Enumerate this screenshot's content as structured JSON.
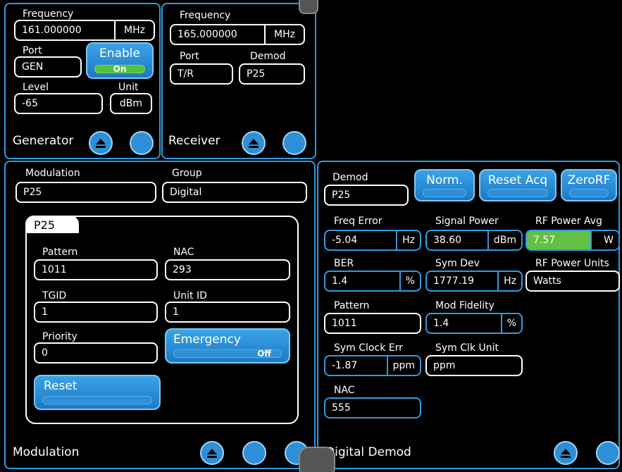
{
  "generator": {
    "title": "Generator",
    "frequency_label": "Frequency",
    "frequency_value": "161.000000",
    "frequency_unit": "MHz",
    "port_label": "Port",
    "port_value": "GEN",
    "enable_label": "Enable",
    "enable_state": "On",
    "level_label": "Level",
    "level_value": "-65",
    "unit_label": "Unit",
    "unit_value": "dBm"
  },
  "receiver": {
    "title": "Receiver",
    "frequency_label": "Frequency",
    "frequency_value": "165.000000",
    "frequency_unit": "MHz",
    "port_label": "Port",
    "port_value": "T/R",
    "demod_label": "Demod",
    "demod_value": "P25"
  },
  "modulation": {
    "title": "Modulation",
    "modulation_label": "Modulation",
    "modulation_value": "P25",
    "group_label": "Group",
    "group_value": "Digital",
    "tab_label": "P25",
    "pattern_label": "Pattern",
    "pattern_value": "1011",
    "nac_label": "NAC",
    "nac_value": "293",
    "tgid_label": "TGID",
    "tgid_value": "1",
    "unit_id_label": "Unit ID",
    "unit_id_value": "1",
    "priority_label": "Priority",
    "priority_value": "0",
    "emergency_label": "Emergency",
    "emergency_state": "Off",
    "reset_label": "Reset"
  },
  "digital_demod": {
    "title": "Digital Demod",
    "demod_label": "Demod",
    "demod_value": "P25",
    "norm_label": "Norm.",
    "reset_acq_label": "Reset Acq",
    "zero_rf_label": "ZeroRF",
    "freq_error_label": "Freq Error",
    "freq_error_value": "-5.04",
    "freq_error_unit": "Hz",
    "signal_power_label": "Signal Power",
    "signal_power_value": "38.60",
    "signal_power_unit": "dBm",
    "rf_power_avg_label": "RF Power Avg",
    "rf_power_avg_value": "7.57",
    "rf_power_avg_unit": "W",
    "ber_label": "BER",
    "ber_value": "1.4",
    "ber_unit": "%",
    "sym_dev_label": "Sym Dev",
    "sym_dev_value": "1777.19",
    "sym_dev_unit": "Hz",
    "rf_power_units_label": "RF Power Units",
    "rf_power_units_value": "Watts",
    "pattern_label": "Pattern",
    "pattern_value": "1011",
    "mod_fidelity_label": "Mod Fidelity",
    "mod_fidelity_value": "1.4",
    "mod_fidelity_unit": "%",
    "sym_clock_err_label": "Sym Clock Err",
    "sym_clock_err_value": "-1.87",
    "sym_clock_err_unit": "ppm",
    "sym_clk_unit_label": "Sym Clk Unit",
    "sym_clk_unit_value": "ppm",
    "nac_label": "NAC",
    "nac_value": "555"
  },
  "icons": {
    "collapse": "eject-up-icon",
    "expand": "circle-button-icon",
    "options": "handle-icon"
  },
  "colors": {
    "accent": "#2f9be0",
    "button": "#2f8fd6",
    "on": "#55c23e",
    "highlight": "#62c043"
  }
}
